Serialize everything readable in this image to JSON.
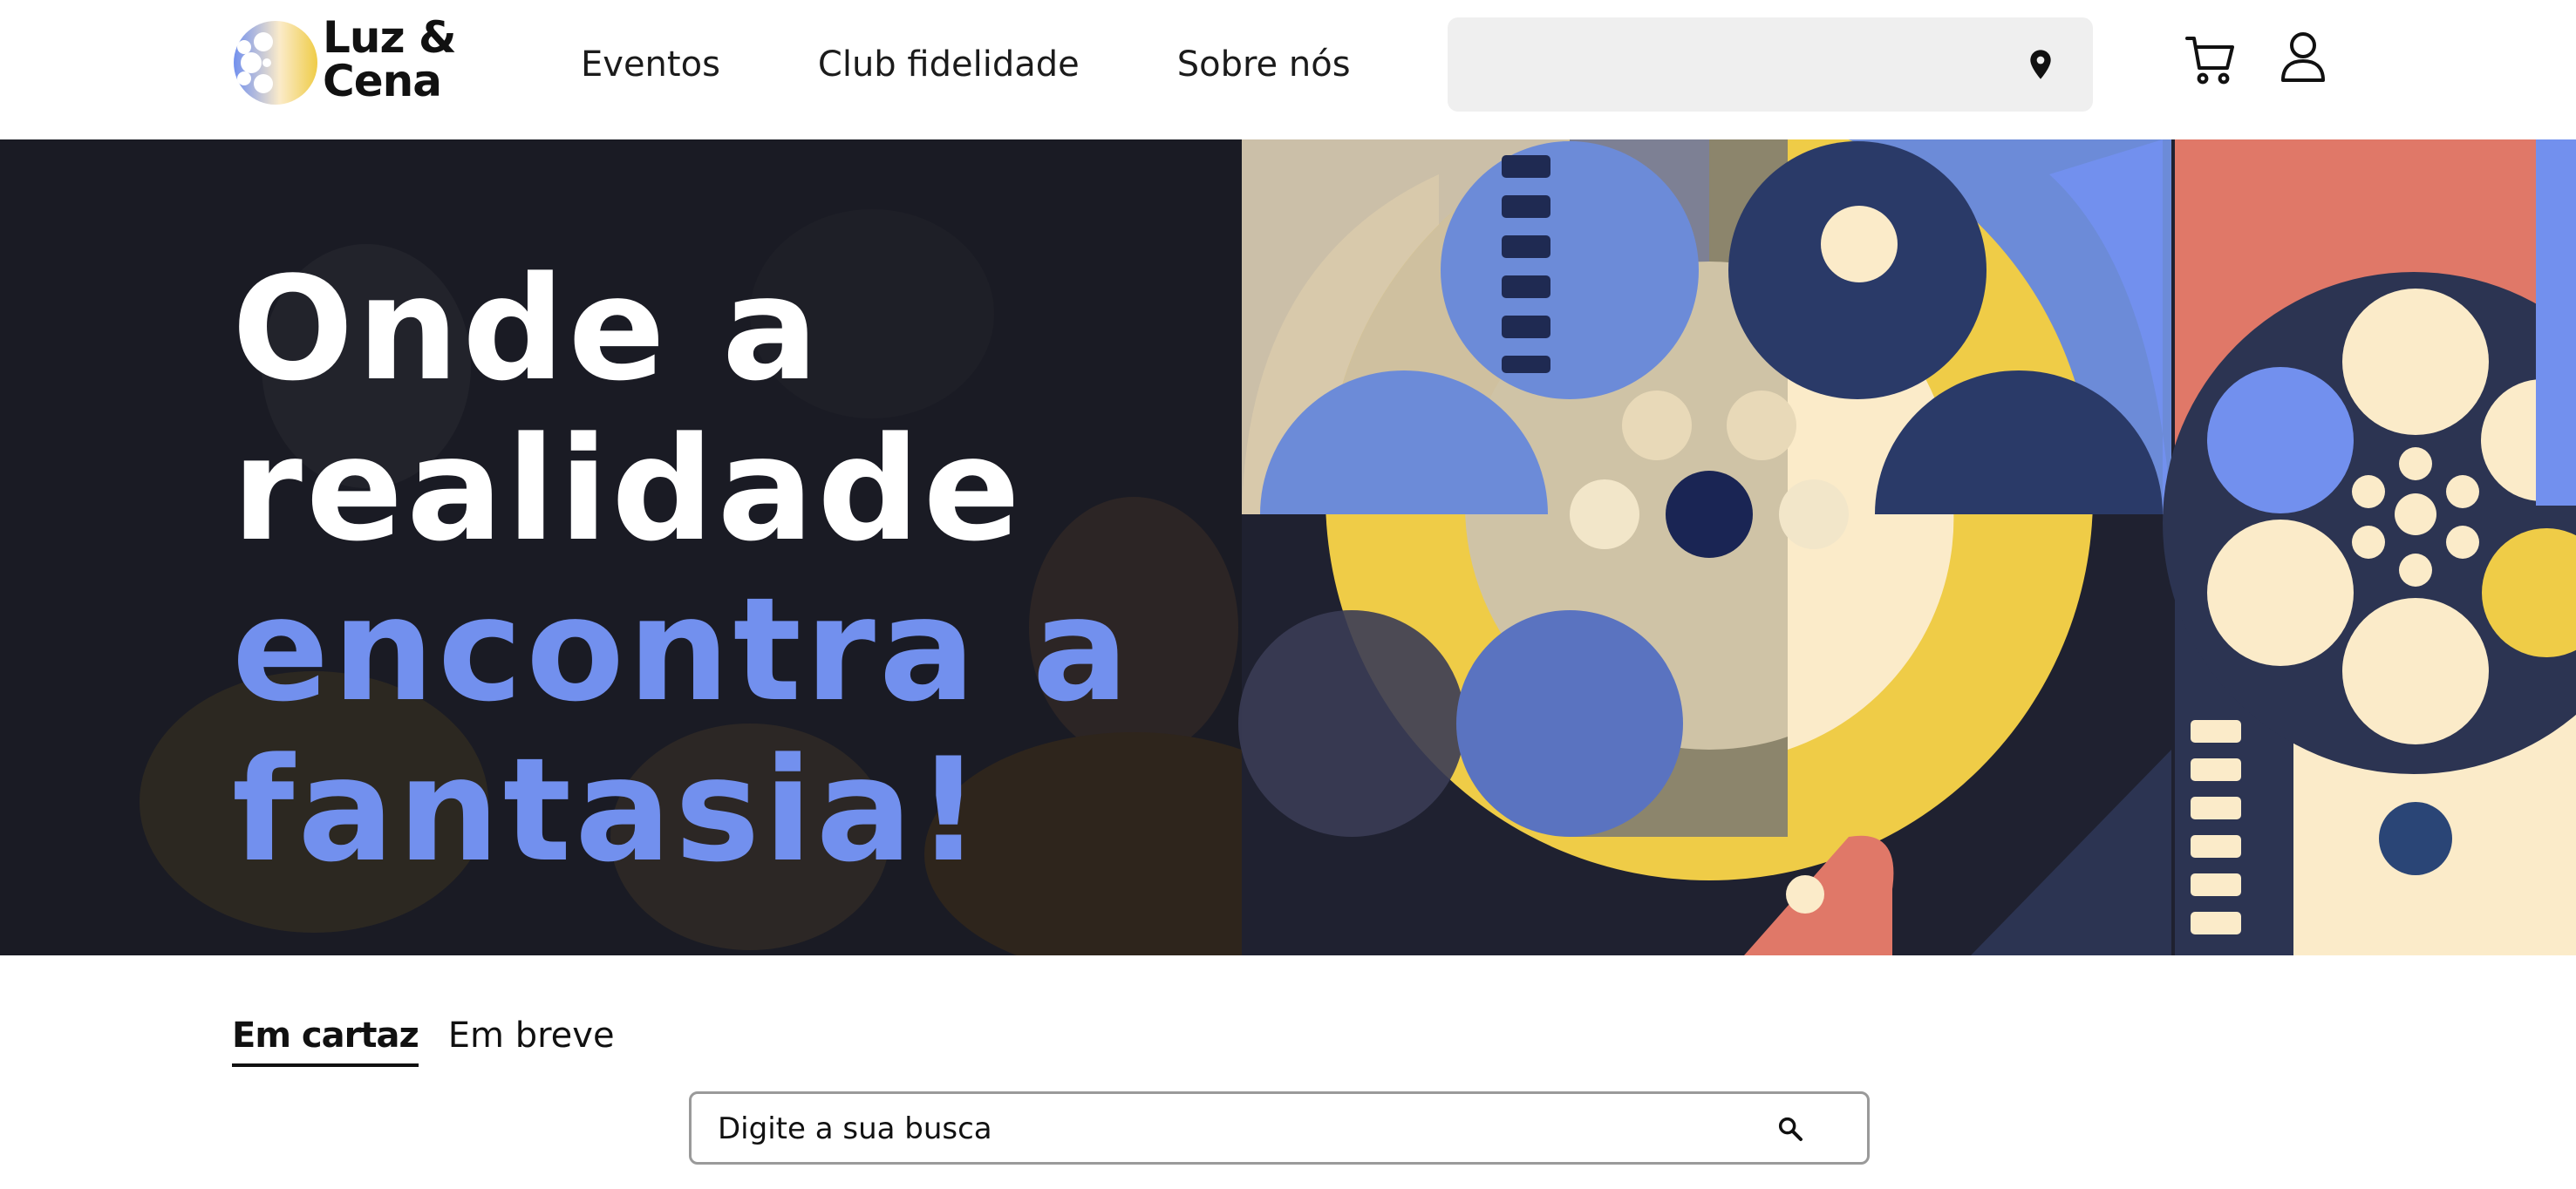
{
  "header": {
    "logo": {
      "line1": "Luz &",
      "line2": "Cena",
      "icon": "film-reel-logo-icon"
    },
    "nav": [
      {
        "label": "Eventos"
      },
      {
        "label": "Club fidelidade"
      },
      {
        "label": "Sobre nós"
      }
    ],
    "location": {
      "value": "",
      "icon": "location-pin-icon"
    },
    "icons": {
      "cart": "cart-icon",
      "user": "user-icon"
    }
  },
  "hero": {
    "title_line1": "Onde a",
    "title_line2": "realidade",
    "title_line3": "encontra a",
    "title_line4": "fantasia!"
  },
  "tabs": [
    {
      "label": "Em cartaz",
      "active": true
    },
    {
      "label": "Em breve",
      "active": false
    }
  ],
  "search": {
    "placeholder": "Digite a sua busca",
    "icon": "search-icon"
  },
  "colors": {
    "accent_blue": "#7290ee",
    "navy": "#2c3452",
    "yellow": "#efcc47",
    "cream": "#fbebc9",
    "coral": "#e07868",
    "search_bg": "#efefef"
  }
}
